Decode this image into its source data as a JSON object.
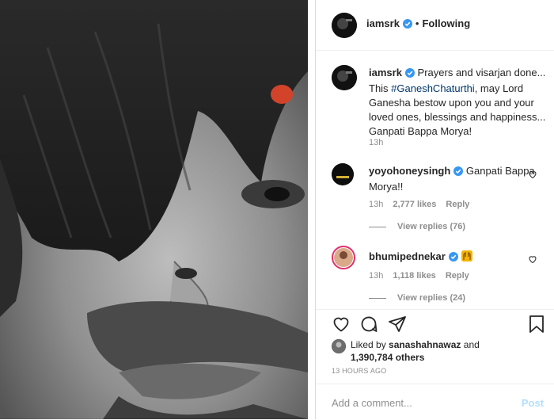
{
  "post": {
    "author": "iamsrk",
    "follow_status": "Following",
    "separator": "•",
    "caption_pre": "Prayers and visarjan done... This ",
    "caption_hashtag": "#GaneshChaturthi",
    "caption_post": ", may Lord Ganesha bestow upon you and your loved ones, blessings and happiness... Ganpati Bappa Morya!",
    "caption_time": "13h"
  },
  "comments": [
    {
      "user": "yoyohoneysingh",
      "text": "Ganpati Bappa Morya!!",
      "time": "13h",
      "likes": "2,777 likes",
      "reply": "Reply",
      "view_replies": "View replies (76)"
    },
    {
      "user": "bhumipednekar",
      "text": "",
      "emoji_icon": "raising-hands-icon",
      "time": "13h",
      "likes": "1,118 likes",
      "reply": "Reply",
      "view_replies": "View replies (24)"
    }
  ],
  "likes": {
    "liked_by_prefix": "Liked by",
    "liked_by_user": "sanashahnawaz",
    "and": "and",
    "others": "1,390,784 others",
    "time_ago": "13 HOURS AGO"
  },
  "add_comment": {
    "placeholder": "Add a comment...",
    "post_label": "Post"
  },
  "colors": {
    "verified": "#3897f0",
    "hashtag": "#00376b",
    "muted": "#8e8e8e",
    "post_disabled": "#b2dffc"
  }
}
